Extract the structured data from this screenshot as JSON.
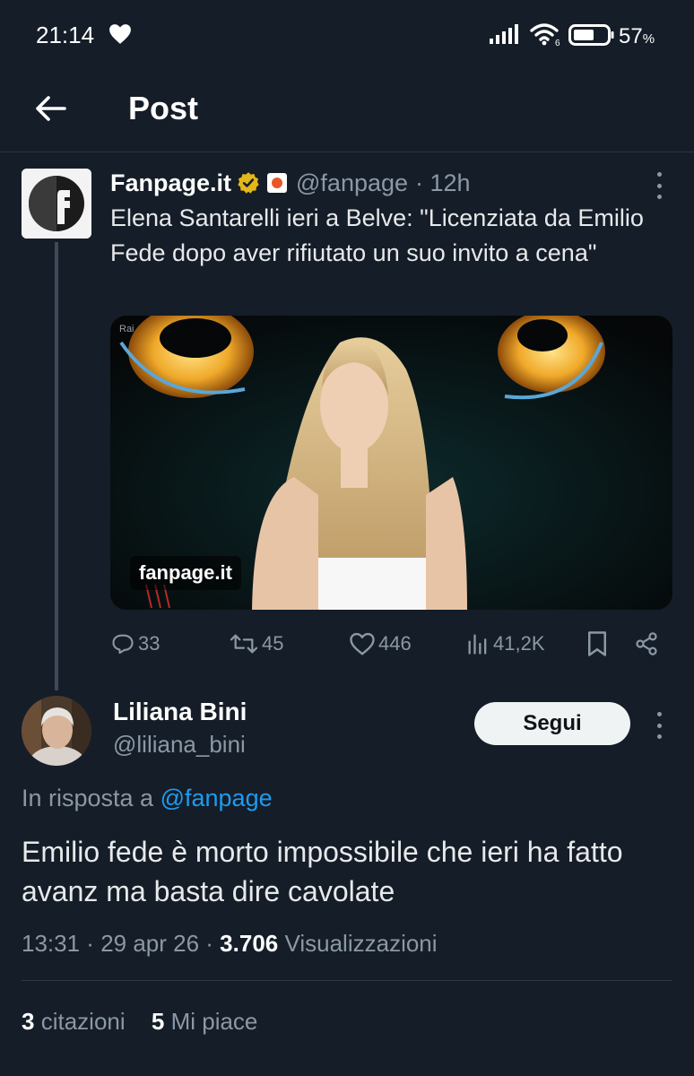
{
  "status_bar": {
    "time": "21:14",
    "battery_percent": "57",
    "battery_unit": "%",
    "wifi_label": "6"
  },
  "header": {
    "title": "Post"
  },
  "parent_tweet": {
    "author_name": "Fanpage.it",
    "handle": "@fanpage",
    "time": "· 12h",
    "text": "Elena Santarelli ieri a Belve: \"Licenziata da Emilio Fede dopo aver rifiutato un suo invito a cena\"",
    "media_watermark": "fanpage.it",
    "media_corner_tag": "Rai",
    "counts": {
      "replies": "33",
      "retweets": "45",
      "likes": "446",
      "views": "41,2K"
    }
  },
  "reply": {
    "author_name": "Liliana Bini",
    "handle": "@liliana_bini",
    "follow_label": "Segui",
    "in_reply_to_prefix": "In risposta a",
    "in_reply_to_handle": "@fanpage",
    "text": "Emilio fede è  morto impossibile che ieri ha fatto avanz ma basta dire cavolate",
    "time": "13:31",
    "date": "29 apr 26",
    "views_count": "3.706",
    "views_label": "Visualizzazioni",
    "quotes_count": "3",
    "quotes_label": "citazioni",
    "likes_count": "5",
    "likes_label": "Mi piace"
  },
  "colors": {
    "background": "#151d28",
    "accent": "#1d9bf0",
    "verified_gold": "#e2b719",
    "muted": "#8b98a5"
  },
  "icons": [
    "heart-icon",
    "signal-icon",
    "wifi-icon",
    "battery-icon",
    "back-arrow-icon",
    "verified-badge-icon",
    "affiliate-icon",
    "more-icon",
    "reply-icon",
    "retweet-icon",
    "like-icon",
    "views-icon",
    "bookmark-icon",
    "share-icon"
  ]
}
